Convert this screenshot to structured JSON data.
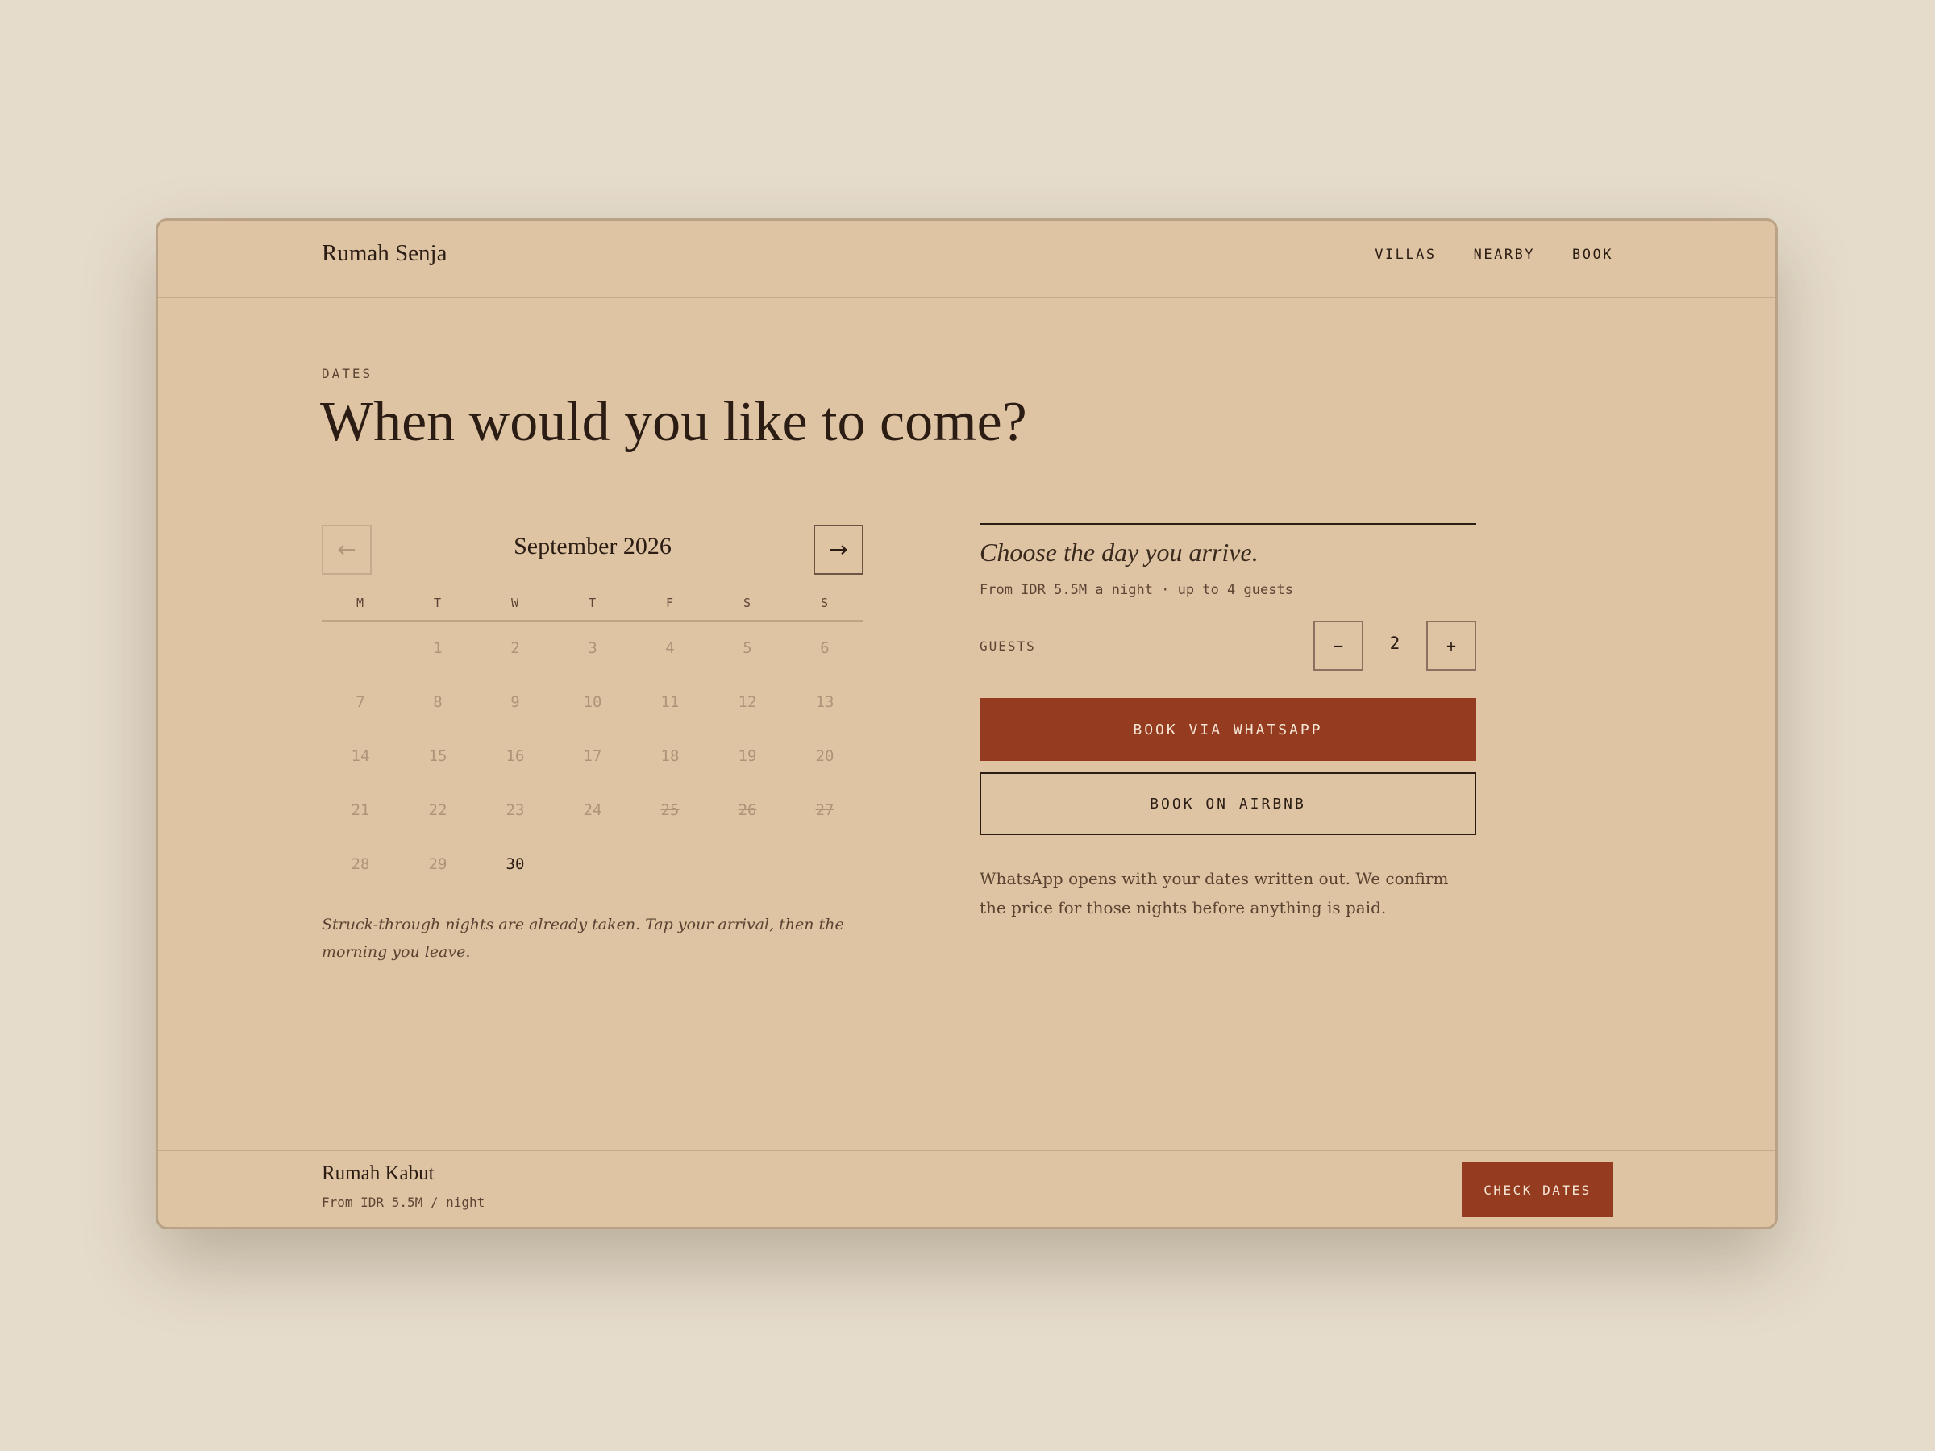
{
  "header": {
    "brand": "Rumah Senja",
    "nav": [
      {
        "label": "VILLAS"
      },
      {
        "label": "NEARBY"
      },
      {
        "label": "BOOK"
      }
    ]
  },
  "section": {
    "eyebrow": "DATES",
    "title": "When would you like to come?"
  },
  "calendar": {
    "prev_icon": "←",
    "next_icon": "→",
    "month": "September 2026",
    "weekdays": [
      "M",
      "T",
      "W",
      "T",
      "F",
      "S",
      "S"
    ],
    "note": "Struck-through nights are already taken. Tap your arrival, then the morning you leave."
  },
  "panel": {
    "heading": "Choose the day you arrive.",
    "subtext": "From IDR 5.5M a night · up to 4 guests",
    "guests": {
      "label": "GUESTS",
      "minus": "−",
      "value": "2",
      "plus": "+"
    },
    "whatsapp_label": "BOOK VIA WHATSAPP",
    "airbnb_label": "BOOK ON AIRBNB",
    "note": "WhatsApp opens with your dates written out. We confirm the price for those nights before anything is paid."
  },
  "footer": {
    "name": "Rumah Kabut",
    "price": "From IDR 5.5M / night",
    "cta": "CHECK DATES"
  },
  "colors": {
    "background": "#e6dccb",
    "card": "#dfc4a4",
    "accent": "#943b20",
    "text": "#2b1d14",
    "muted": "#ae9478"
  }
}
